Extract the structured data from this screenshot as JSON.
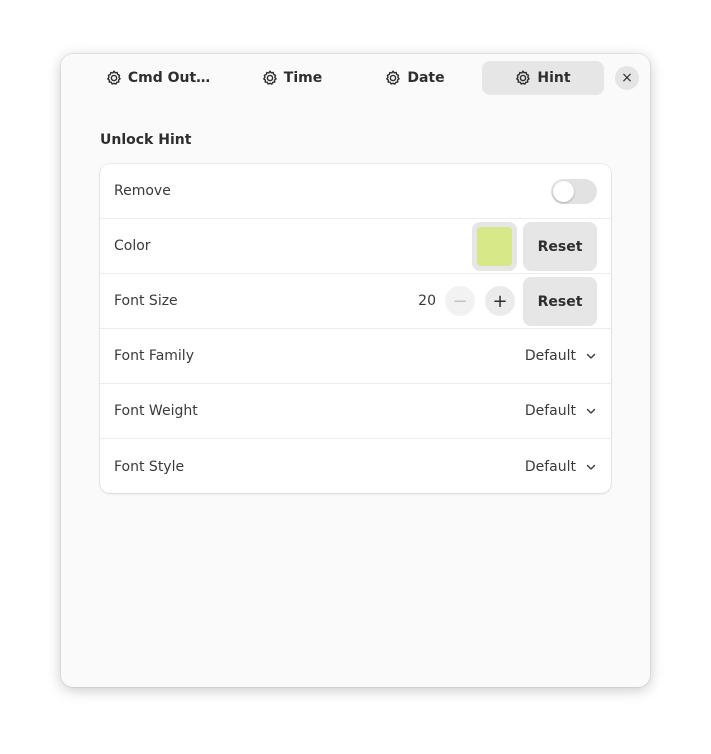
{
  "tabs": [
    {
      "label": "Cmd Out…",
      "icon": "gear-icon",
      "active": false
    },
    {
      "label": "Time",
      "icon": "gear-icon",
      "active": false
    },
    {
      "label": "Date",
      "icon": "gear-icon",
      "active": false
    },
    {
      "label": "Hint",
      "icon": "gear-icon",
      "active": true
    }
  ],
  "close_label": "×",
  "section": {
    "title": "Unlock Hint"
  },
  "rows": {
    "remove": {
      "label": "Remove",
      "toggle_on": false
    },
    "color": {
      "label": "Color",
      "swatch_color": "#d6e887",
      "reset_label": "Reset"
    },
    "font_size": {
      "label": "Font Size",
      "value": "20",
      "minus_label": "−",
      "plus_label": "+",
      "reset_label": "Reset"
    },
    "font_family": {
      "label": "Font Family",
      "value": "Default"
    },
    "font_weight": {
      "label": "Font Weight",
      "value": "Default"
    },
    "font_style": {
      "label": "Font Style",
      "value": "Default"
    }
  },
  "colors": {
    "window_bg": "#fafafa",
    "card_bg": "#ffffff",
    "button_bg": "#e6e6e6",
    "text": "#2e2e2e"
  }
}
